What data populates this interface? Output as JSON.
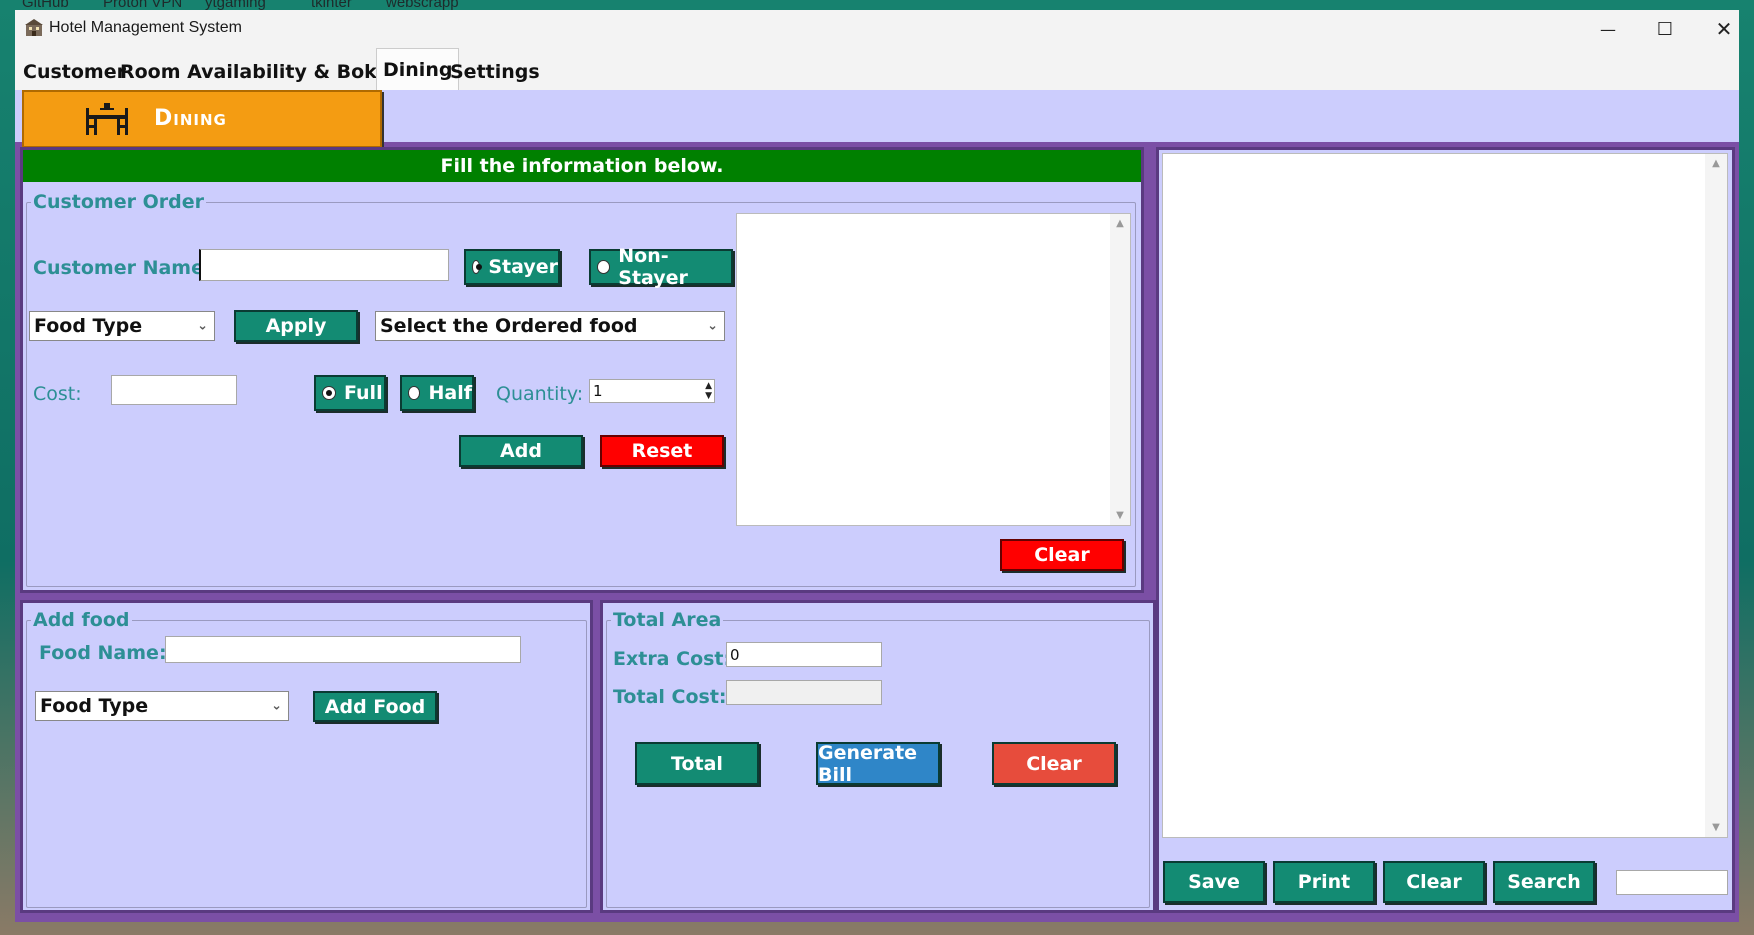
{
  "bookmarks": [
    "GitHub",
    "Proton VPN",
    "ytgaming",
    "tkinter",
    "webscrapp"
  ],
  "window": {
    "title": "Hotel Management System",
    "minimize": "—",
    "maximize": "☐",
    "close": "✕"
  },
  "tabs": [
    {
      "label": "Customer",
      "active": false
    },
    {
      "label": "Room Availability & Bokking",
      "active": false
    },
    {
      "label": "Dining",
      "active": true
    },
    {
      "label": "Settings",
      "active": false
    }
  ],
  "header": {
    "title": "Dining"
  },
  "banner": {
    "text": "Fill the information below."
  },
  "customer_order": {
    "legend": "Customer Order",
    "customer_name_label": "Customer Name:",
    "customer_name_value": "",
    "stayer_label": "Stayer",
    "non_stayer_label": "Non-Stayer",
    "food_type_selected": "Food Type",
    "apply_label": "Apply",
    "ordered_food_selected": "Select the Ordered food",
    "cost_label": "Cost:",
    "cost_value": "",
    "full_label": "Full",
    "half_label": "Half",
    "quantity_label": "Quantity:",
    "quantity_value": "1",
    "add_label": "Add",
    "reset_label": "Reset",
    "clear_label": "Clear"
  },
  "add_food": {
    "legend": "Add food",
    "food_name_label": "Food Name:",
    "food_name_value": "",
    "food_type_selected": "Food Type",
    "add_food_label": "Add Food"
  },
  "total_area": {
    "legend": "Total Area",
    "extra_cost_label": "Extra Cost:",
    "extra_cost_value": "0",
    "total_cost_label": "Total Cost:",
    "total_cost_value": "",
    "total_label": "Total",
    "generate_bill_label": "Generate Bill",
    "clear_label": "Clear"
  },
  "bill_panel": {
    "save_label": "Save",
    "print_label": "Print",
    "clear_label": "Clear",
    "search_label": "Search",
    "search_value": ""
  },
  "colors": {
    "lavender": "#cccdfd",
    "purple": "#7b4fa5",
    "teal": "#138b73",
    "red": "#ff0000",
    "green_banner": "#008000",
    "orange_header": "#f49c12",
    "blue_button": "#2f86c8",
    "coral_button": "#e74c3c"
  }
}
